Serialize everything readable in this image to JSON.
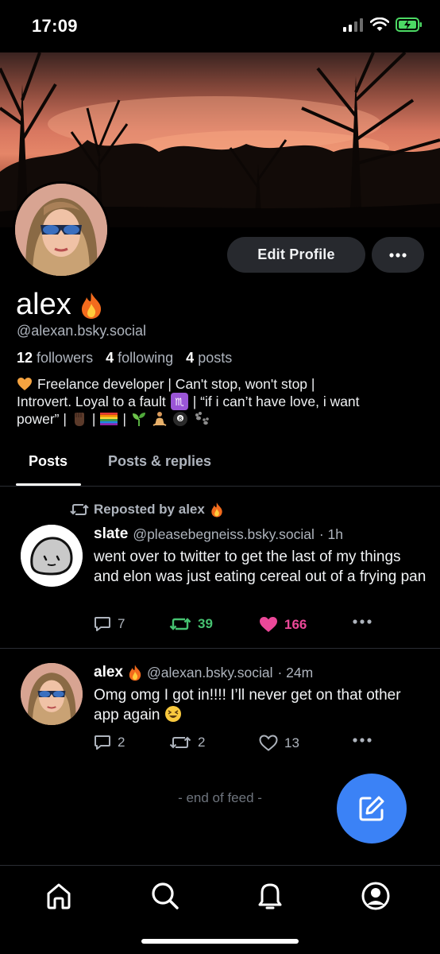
{
  "status_bar": {
    "time": "17:09"
  },
  "profile": {
    "edit_button": "Edit Profile",
    "display_name": "alex",
    "handle": "@alexan.bsky.social",
    "followers_count": "12",
    "followers_label": "followers",
    "following_count": "4",
    "following_label": "following",
    "posts_count": "4",
    "posts_label": "posts",
    "bio_line1": "Freelance developer  |  Can't stop, won't stop  |",
    "bio_line2": "Introvert. Loyal to a fault",
    "bio_line2b": "|  “if i can’t have love, i want",
    "bio_line3": "power”  |",
    "bio_sep": "|"
  },
  "tabs": [
    {
      "label": "Posts",
      "active": true
    },
    {
      "label": "Posts & replies",
      "active": false
    }
  ],
  "feed": {
    "posts": [
      {
        "repost_label": "Reposted by alex",
        "author_name": "slate",
        "author_handle": "@pleasebegneiss.bsky.social",
        "time": "· 1h",
        "text": "went over to twitter to get the last of my things and elon was just eating cereal out of a frying pan",
        "replies": "7",
        "reposts": "39",
        "likes": "166"
      },
      {
        "author_name": "alex",
        "author_handle": "@alexan.bsky.social",
        "time": "· 24m",
        "text": "Omg omg I got in!!!! I’ll never get on that other app again",
        "replies": "2",
        "reposts": "2",
        "likes": "13"
      }
    ],
    "end_label": "- end of feed -"
  },
  "colors": {
    "accent": "#3b82f6",
    "repost_active": "#46c271",
    "like_active": "#ec4899",
    "button_bg": "#27292e"
  },
  "icons": [
    "signal-icon",
    "wifi-icon",
    "battery-icon",
    "more-icon",
    "reply-icon",
    "repost-icon",
    "heart-icon",
    "compose-icon",
    "home-icon",
    "search-icon",
    "bell-icon",
    "profile-icon"
  ]
}
